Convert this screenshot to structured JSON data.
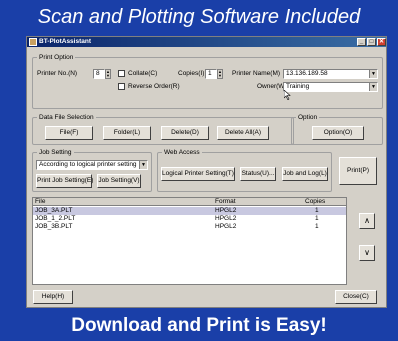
{
  "banner": {
    "top": "Scan and Plotting Software Included",
    "bottom": "Download and Print is Easy!"
  },
  "window": {
    "title": "BT-PlotAssistant",
    "min": "_",
    "max": "□",
    "close": "✕"
  },
  "print_option": {
    "legend": "Print Option",
    "printer_no_label": "Printer No.(N)",
    "printer_no_value": "8",
    "collate_label": "Collate(C)",
    "reverse_order_label": "Reverse Order(R)",
    "copies_label": "Copies(I)",
    "copies_value": "1",
    "printer_name_label": "Printer Name(M)",
    "printer_name_value": "13.136.189.58",
    "owner_label": "Owner(W)",
    "owner_value": "Training"
  },
  "data_file_selection": {
    "legend": "Data File Selection",
    "file_button": "File(F)",
    "folder_button": "Folder(L)",
    "delete_button": "Delete(D)",
    "delete_all_button": "Delete All(A)"
  },
  "option": {
    "legend": "Option",
    "option_button": "Option(O)"
  },
  "job_setting": {
    "legend": "Job Setting",
    "select_value": "According to logical printer setting",
    "print_job_setting_button": "Print Job Setting(E)",
    "job_setting_button": "Job Setting(V)"
  },
  "web_access": {
    "legend": "Web Access",
    "logical_printer_setting_button": "Logical Printer Setting(T)",
    "status_button": "Status(U)...",
    "job_and_log_button": "Job and Log(L)"
  },
  "print_button": "Print(P)",
  "file_list": {
    "headers": [
      "File",
      "Format",
      "Copies"
    ],
    "rows": [
      {
        "file": "JOB_3A.PLT",
        "format": "HPGL2",
        "copies": "1"
      },
      {
        "file": "JOB_1_2.PLT",
        "format": "HPGL2",
        "copies": "1"
      },
      {
        "file": "JOB_3B.PLT",
        "format": "HPGL2",
        "copies": "1"
      }
    ]
  },
  "up_button": "∧",
  "down_button": "∨",
  "help_button": "Help(H)",
  "close_button": "Close(C)"
}
